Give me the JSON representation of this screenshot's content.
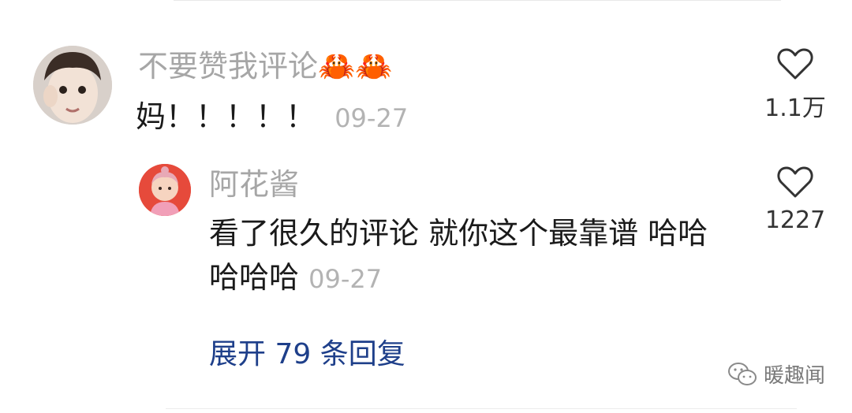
{
  "comment": {
    "username": "不要赞我评论🦀🦀",
    "text": "妈！！！！！",
    "date": "09-27",
    "like_count": "1.1万"
  },
  "reply": {
    "username": "阿花酱",
    "text": "看了很久的评论 就你这个最靠谱 哈哈哈哈哈",
    "date": "09-27",
    "like_count": "1227"
  },
  "expand_label": "展开 79 条回复",
  "watermark": "暖趣闻",
  "icons": {
    "like": "heart-outline-icon",
    "watermark": "wechat-icon"
  },
  "colors": {
    "username": "#a6a6a6",
    "link": "#1e3f8a",
    "reply_avatar_bg": "#e64a3b"
  }
}
